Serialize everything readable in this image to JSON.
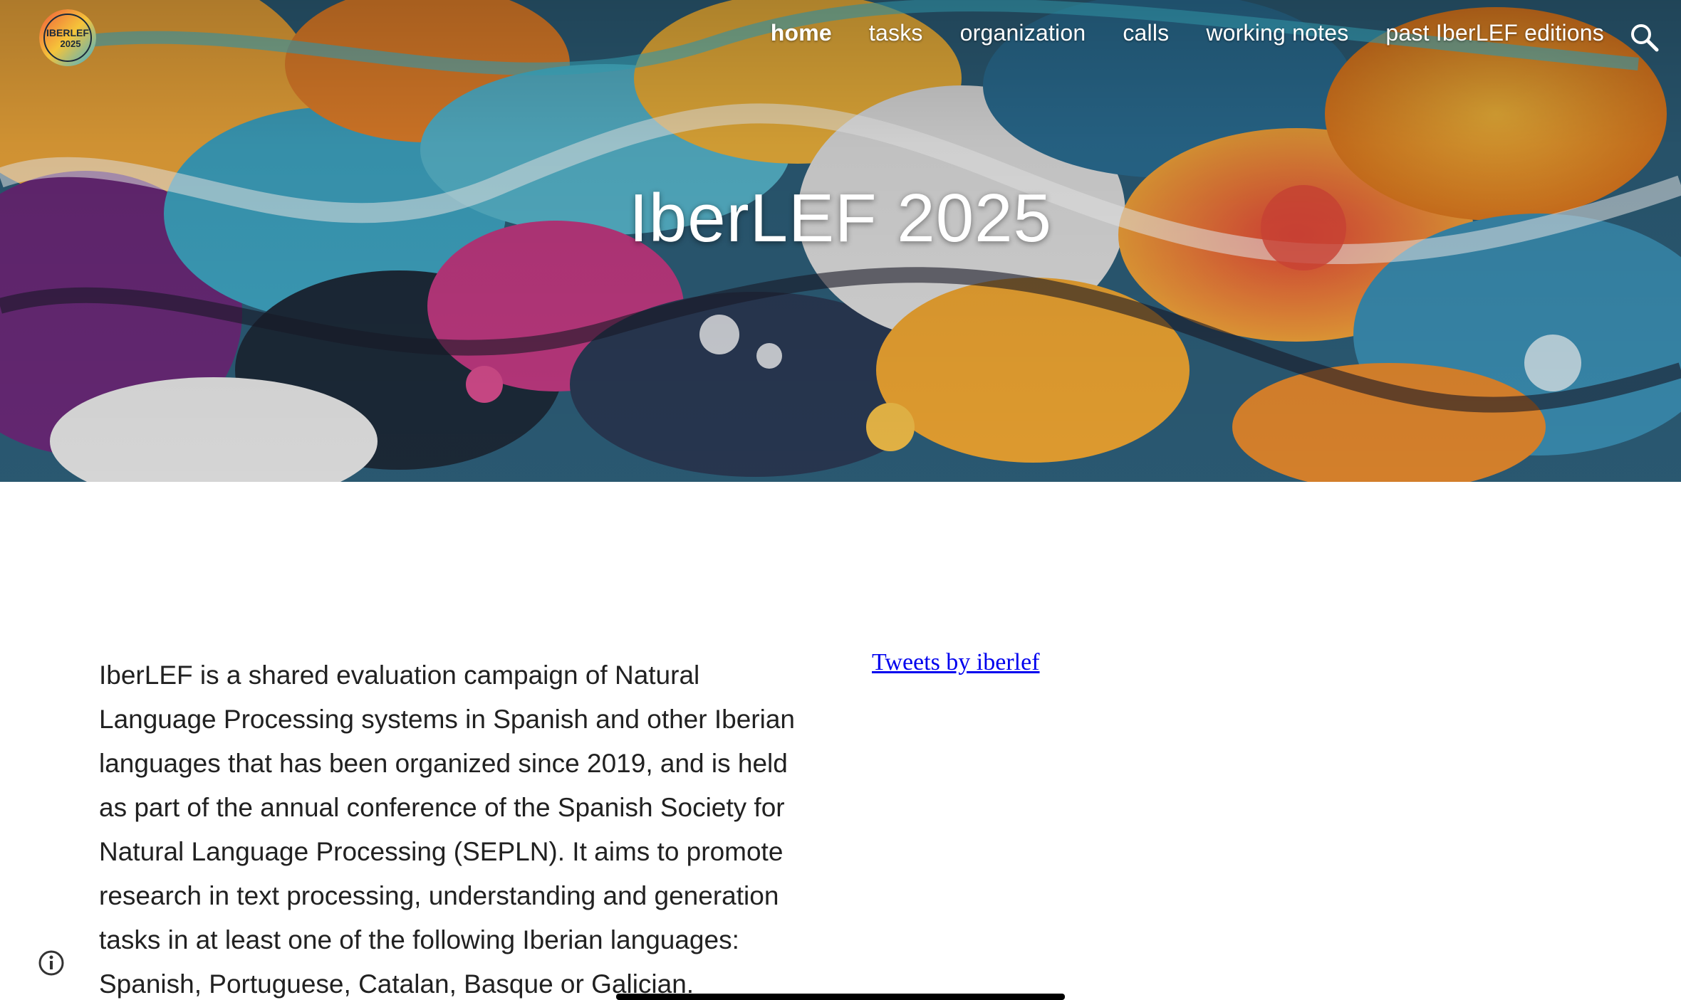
{
  "site": {
    "logo_text_line1": "IBERLEF",
    "logo_text_line2": "2025"
  },
  "nav": {
    "items": [
      {
        "label": "home",
        "active": true
      },
      {
        "label": "tasks",
        "active": false
      },
      {
        "label": "organization",
        "active": false
      },
      {
        "label": "calls",
        "active": false
      },
      {
        "label": "working notes",
        "active": false
      },
      {
        "label": "past IberLEF editions",
        "active": false
      }
    ],
    "search_icon": "search-icon"
  },
  "hero": {
    "title": "IberLEF 2025"
  },
  "main": {
    "intro": "IberLEF is a shared evaluation campaign of Natural Language Processing systems in Spanish and other Iberian languages that has been organized since 2019, and is held as part of the annual conference of the Spanish Society for Natural Language Processing (SEPLN). It aims to promote research in text processing, understanding and generation tasks in at least one of the following Iberian languages: Spanish, Portuguese, Catalan, Basque or Galician.",
    "tweets_link": "Tweets by iberlef"
  },
  "footer": {
    "info_icon": "info-icon"
  },
  "colors": {
    "link": "#0000ee",
    "body_text": "#212121",
    "nav_text": "#ffffff"
  }
}
